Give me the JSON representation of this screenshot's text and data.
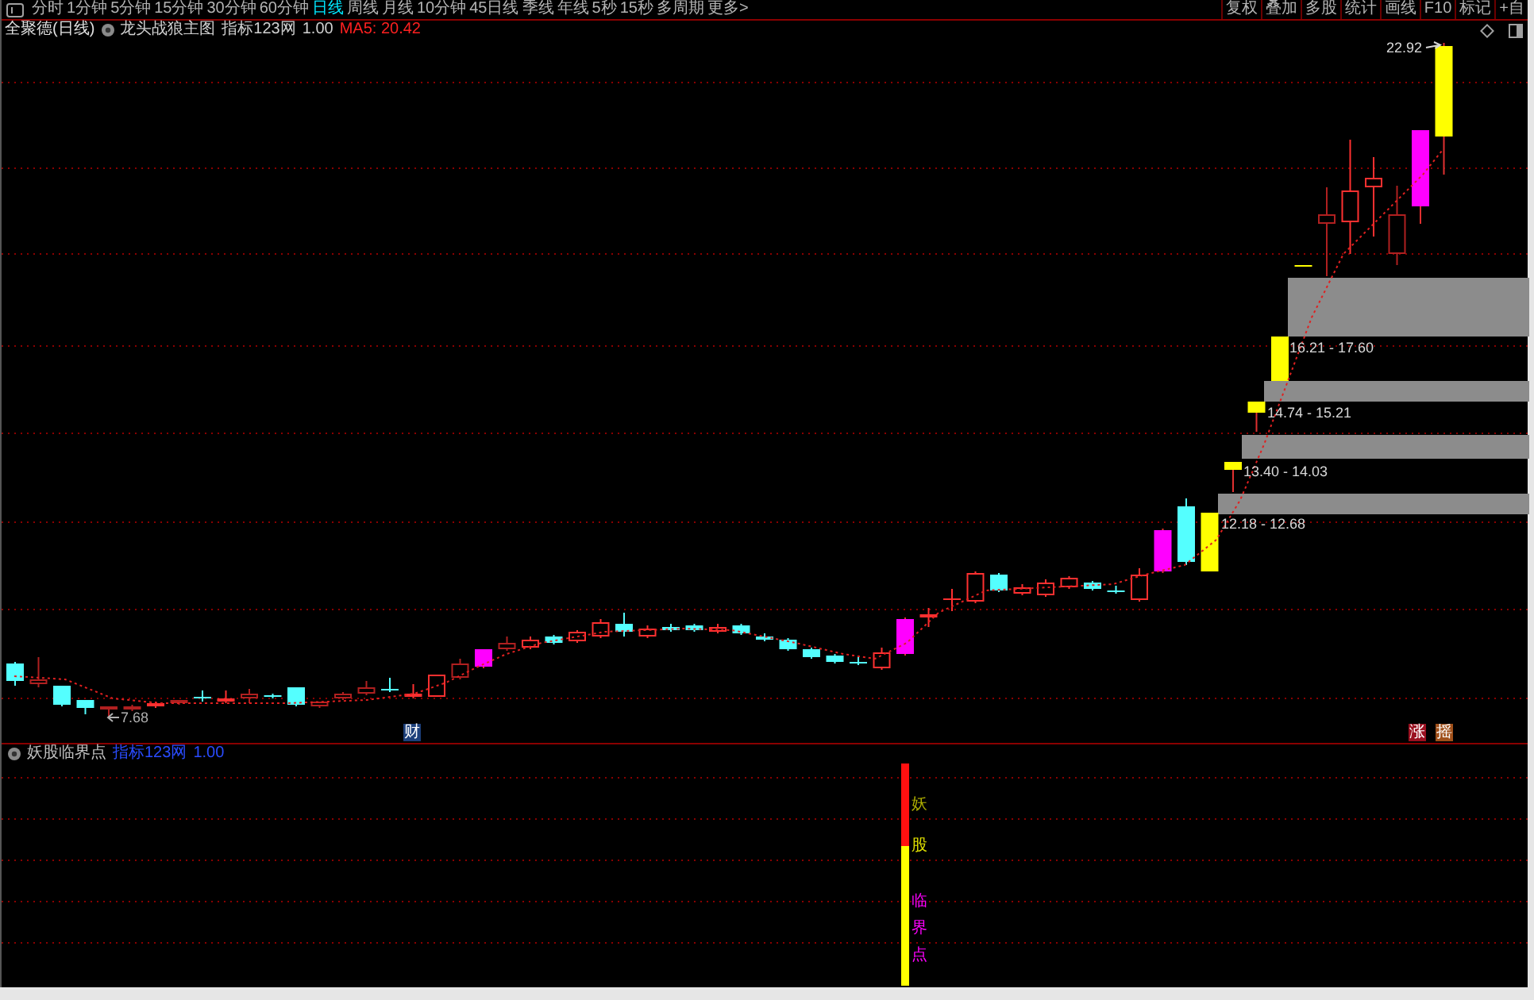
{
  "toolbar": {
    "tabs": [
      {
        "label": "分时",
        "selected": false
      },
      {
        "label": "1分钟",
        "selected": false
      },
      {
        "label": "5分钟",
        "selected": false
      },
      {
        "label": "15分钟",
        "selected": false
      },
      {
        "label": "30分钟",
        "selected": false
      },
      {
        "label": "60分钟",
        "selected": false
      },
      {
        "label": "日线",
        "selected": true
      },
      {
        "label": "周线",
        "selected": false
      },
      {
        "label": "月线",
        "selected": false
      },
      {
        "label": "10分钟",
        "selected": false
      },
      {
        "label": "45日线",
        "selected": false
      },
      {
        "label": "季线",
        "selected": false
      },
      {
        "label": "年线",
        "selected": false
      },
      {
        "label": "5秒",
        "selected": false
      },
      {
        "label": "15秒",
        "selected": false
      },
      {
        "label": "多周期",
        "selected": false
      },
      {
        "label": "更多>",
        "selected": false
      }
    ],
    "tools": [
      "复权",
      "叠加",
      "多股",
      "统计",
      "画线",
      "F10",
      "标记",
      "+自"
    ]
  },
  "main_chart": {
    "title": "全聚德(日线)",
    "indicator_name": "龙头战狼主图",
    "source": "指标123网",
    "param": "1.00",
    "ma": "MA5: 20.42",
    "high_label": "22.92",
    "low_label": "7.68",
    "price_zones": [
      {
        "label": "16.21 - 17.60"
      },
      {
        "label": "14.74 - 15.21"
      },
      {
        "label": "13.40 - 14.03"
      },
      {
        "label": "12.18 - 12.68"
      }
    ],
    "tags": [
      {
        "text": "财",
        "color": "#1c3f7a"
      },
      {
        "text": "涨",
        "color": "#9a1020"
      },
      {
        "text": "摇",
        "color": "#a0501a"
      }
    ]
  },
  "sub_chart": {
    "title": "妖股临界点",
    "source": "指标123网",
    "param": "1.00",
    "signals": [
      {
        "text": "妖",
        "color": "#b0b000"
      },
      {
        "text": "股",
        "color": "#e0e000"
      },
      {
        "text": "临",
        "color": "#ff00ff"
      },
      {
        "text": "界",
        "color": "#ff00ff"
      },
      {
        "text": "点",
        "color": "#ff00ff"
      }
    ]
  }
}
